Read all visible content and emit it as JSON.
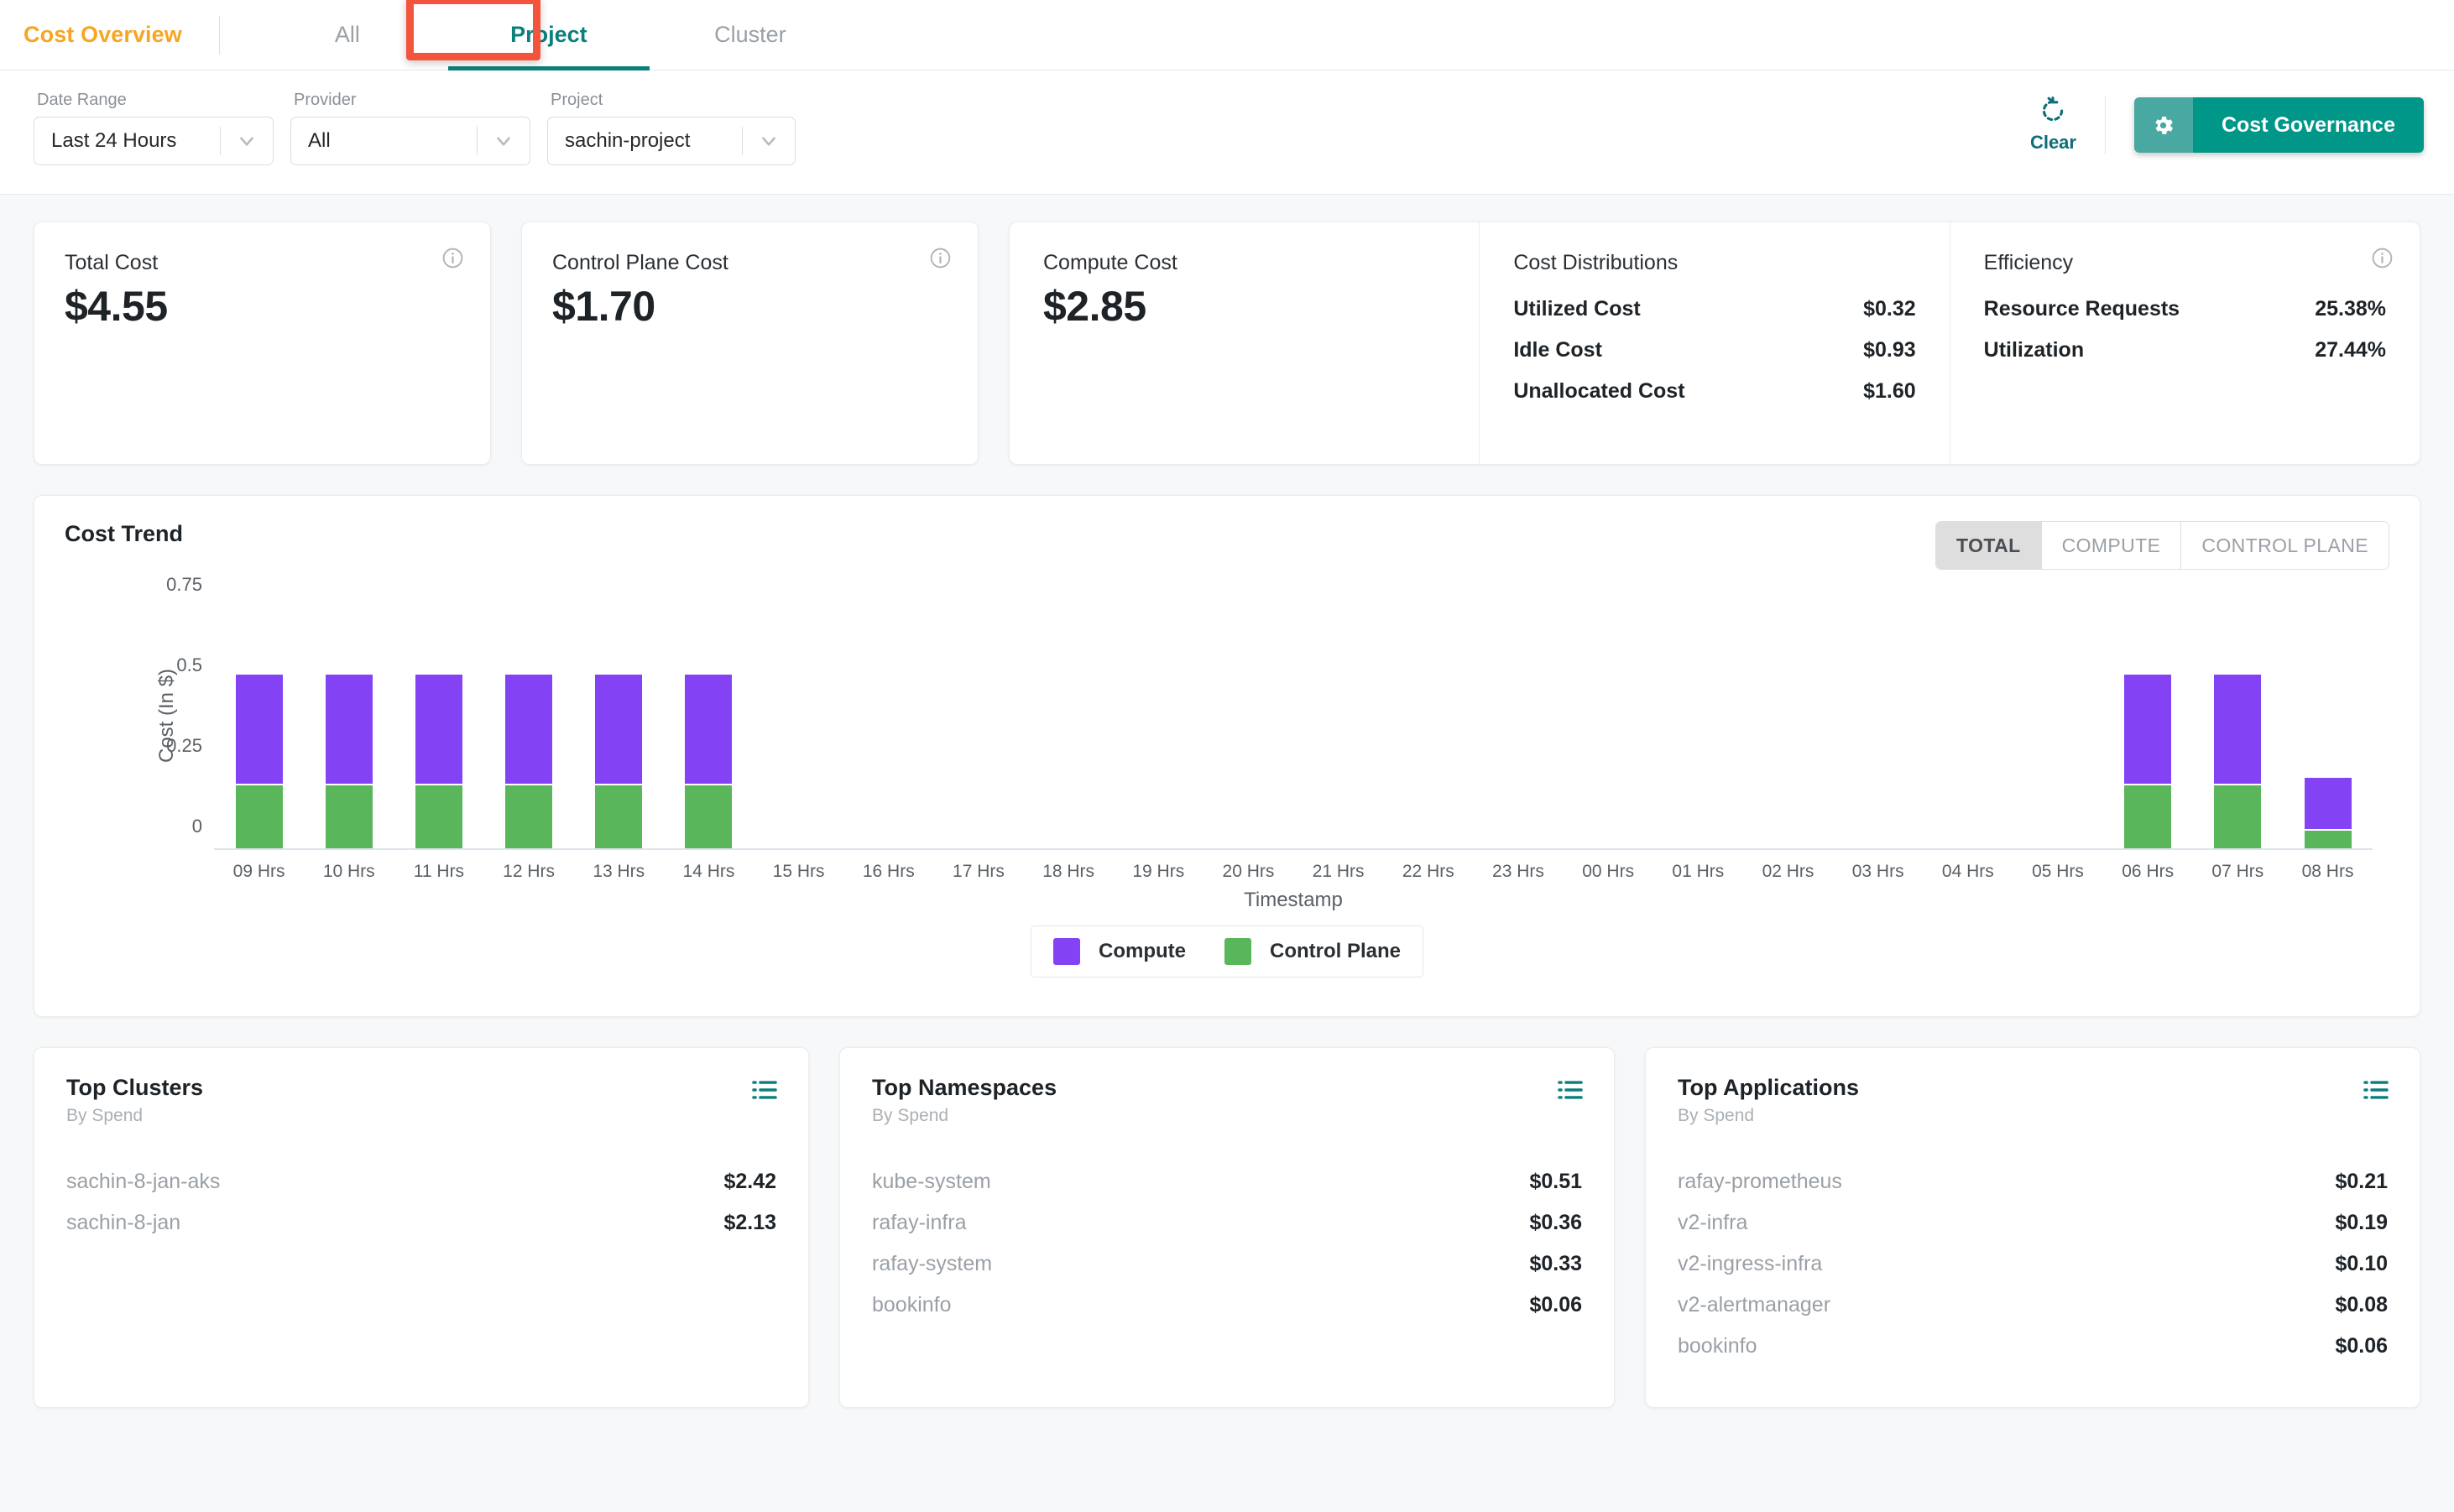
{
  "header": {
    "brand": "Cost Overview",
    "tabs": [
      {
        "label": "All",
        "active": false
      },
      {
        "label": "Project",
        "active": true
      },
      {
        "label": "Cluster",
        "active": false
      }
    ]
  },
  "filters": {
    "date_range": {
      "label": "Date Range",
      "value": "Last 24 Hours"
    },
    "provider": {
      "label": "Provider",
      "value": "All"
    },
    "project": {
      "label": "Project",
      "value": "sachin-project"
    },
    "clear": {
      "label": "Clear",
      "icon": "refresh-clear-icon"
    },
    "governance": {
      "label": "Cost Governance",
      "icon": "gear-icon",
      "color": "#009688"
    }
  },
  "kpis": [
    {
      "title": "Total Cost",
      "value": "$4.55",
      "has_info": true
    },
    {
      "title": "Control Plane Cost",
      "value": "$1.70",
      "has_info": true
    },
    {
      "title": "Compute Cost",
      "value": "$2.85",
      "has_info": false
    }
  ],
  "cost_distributions": {
    "title": "Cost Distributions",
    "rows": [
      {
        "label": "Utilized Cost",
        "value": "$0.32"
      },
      {
        "label": "Idle Cost",
        "value": "$0.93"
      },
      {
        "label": "Unallocated Cost",
        "value": "$1.60"
      }
    ]
  },
  "efficiency": {
    "title": "Efficiency",
    "has_info": true,
    "rows": [
      {
        "label": "Resource Requests",
        "value": "25.38%"
      },
      {
        "label": "Utilization",
        "value": "27.44%"
      }
    ]
  },
  "cost_trend": {
    "title": "Cost Trend",
    "toggles": [
      {
        "label": "TOTAL",
        "active": true
      },
      {
        "label": "COMPUTE",
        "active": false
      },
      {
        "label": "CONTROL PLANE",
        "active": false
      }
    ]
  },
  "chart_data": {
    "type": "bar",
    "title": "Cost Trend",
    "stacked": true,
    "xlabel": "Timestamp",
    "ylabel": "Cost (In $)",
    "ylim": [
      0,
      0.75
    ],
    "yticks": [
      0,
      0.25,
      0.5,
      0.75
    ],
    "ytick_labels": [
      "0",
      "0.25",
      "0.5",
      "0.75"
    ],
    "grid": false,
    "legend_position": "bottom",
    "categories": [
      "09 Hrs",
      "10 Hrs",
      "11 Hrs",
      "12 Hrs",
      "13 Hrs",
      "14 Hrs",
      "15 Hrs",
      "16 Hrs",
      "17 Hrs",
      "18 Hrs",
      "19 Hrs",
      "20 Hrs",
      "21 Hrs",
      "22 Hrs",
      "23 Hrs",
      "00 Hrs",
      "01 Hrs",
      "02 Hrs",
      "03 Hrs",
      "04 Hrs",
      "05 Hrs",
      "06 Hrs",
      "07 Hrs",
      "08 Hrs"
    ],
    "series": [
      {
        "name": "Control Plane",
        "color": "#59b65a",
        "values": [
          0.2,
          0.2,
          0.2,
          0.2,
          0.2,
          0.2,
          0,
          0,
          0,
          0,
          0,
          0,
          0,
          0,
          0,
          0,
          0,
          0,
          0,
          0,
          0,
          0.2,
          0.2,
          0.06
        ]
      },
      {
        "name": "Compute",
        "color": "#8442f5",
        "values": [
          0.34,
          0.34,
          0.34,
          0.34,
          0.34,
          0.34,
          0,
          0,
          0,
          0,
          0,
          0,
          0,
          0,
          0,
          0,
          0,
          0,
          0,
          0,
          0,
          0.34,
          0.34,
          0.16
        ]
      }
    ],
    "legend": [
      {
        "name": "Compute",
        "color": "#8442f5"
      },
      {
        "name": "Control Plane",
        "color": "#59b65a"
      }
    ]
  },
  "panels": [
    {
      "title": "Top Clusters",
      "subtitle": "By Spend",
      "menu_icon": "list-menu-icon",
      "rows": [
        {
          "name": "sachin-8-jan-aks",
          "value": "$2.42"
        },
        {
          "name": "sachin-8-jan",
          "value": "$2.13"
        }
      ]
    },
    {
      "title": "Top Namespaces",
      "subtitle": "By Spend",
      "menu_icon": "list-menu-icon",
      "rows": [
        {
          "name": "kube-system",
          "value": "$0.51"
        },
        {
          "name": "rafay-infra",
          "value": "$0.36"
        },
        {
          "name": "rafay-system",
          "value": "$0.33"
        },
        {
          "name": "bookinfo",
          "value": "$0.06"
        }
      ]
    },
    {
      "title": "Top Applications",
      "subtitle": "By Spend",
      "menu_icon": "list-menu-icon",
      "rows": [
        {
          "name": "rafay-prometheus",
          "value": "$0.21"
        },
        {
          "name": "v2-infra",
          "value": "$0.19"
        },
        {
          "name": "v2-ingress-infra",
          "value": "$0.10"
        },
        {
          "name": "v2-alertmanager",
          "value": "$0.08"
        },
        {
          "name": "bookinfo",
          "value": "$0.06"
        }
      ]
    }
  ]
}
